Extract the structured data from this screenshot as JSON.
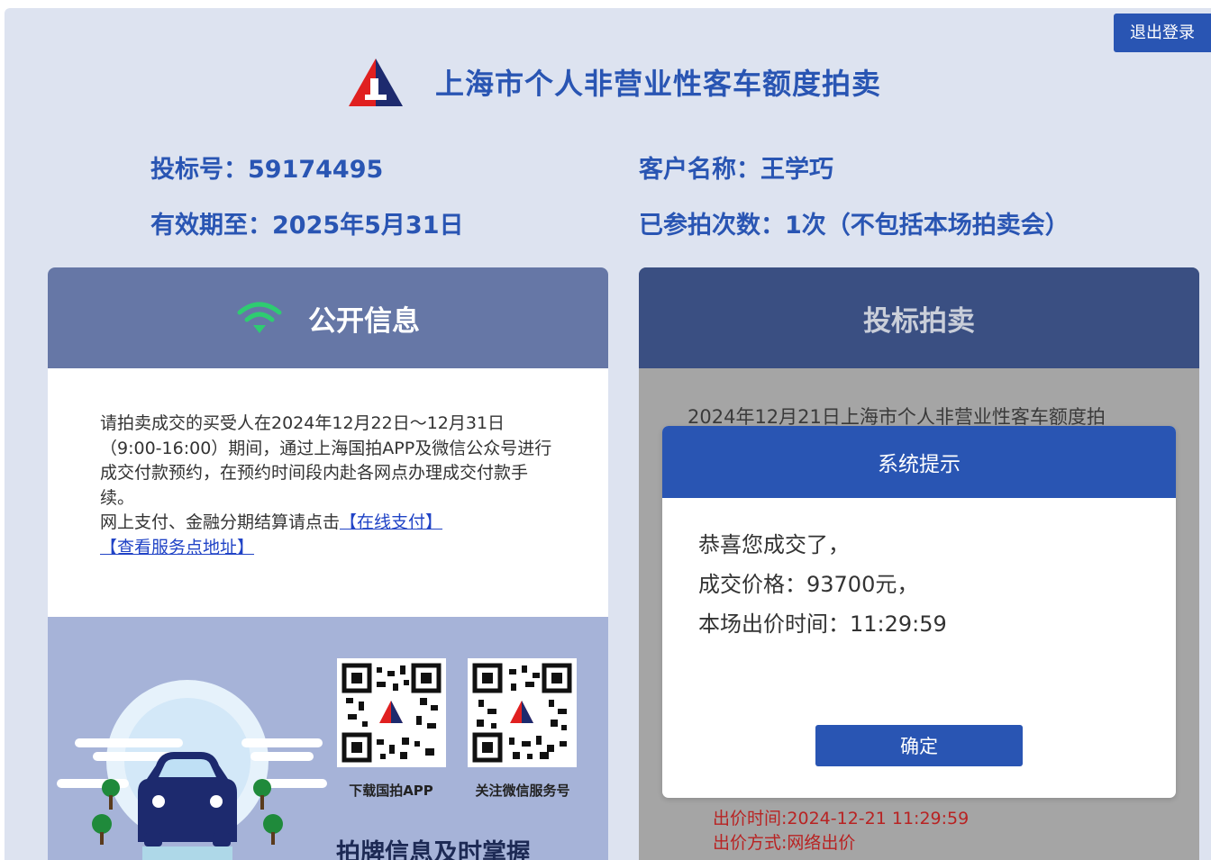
{
  "header": {
    "logout_label": "退出登录",
    "title": "上海市个人非营业性客车额度拍卖"
  },
  "account": {
    "bid_number_label": "投标号：",
    "bid_number": "59174495",
    "customer_label": "客户名称：",
    "customer_name": "王学巧",
    "valid_until_label": "有效期至：",
    "valid_until": "2025年5月31日",
    "participation_label": "已参拍次数：",
    "participation": "1次（不包括本场拍卖会）"
  },
  "public_info": {
    "title": "公开信息",
    "notice": "请拍卖成交的买受人在2024年12月22日～12月31日（9:00-16:00）期间，通过上海国拍APP及微信公众号进行成交付款预约，在预约时间段内赴各网点办理成交付款手续。",
    "pay_prefix": "网上支付、金融分期结算请点击",
    "pay_link": "【在线支付】",
    "service_link": "【查看服务点地址】",
    "qr_app_label": "下载国拍APP",
    "qr_wechat_label": "关注微信服务号",
    "slogan": "拍牌信息及时掌握"
  },
  "auction": {
    "title": "投标拍卖",
    "session_line": "2024年12月21日上海市个人非营业性客车额度拍",
    "bid_time": "出价时间:2024-12-21 11:29:59",
    "bid_method": "出价方式:网络出价"
  },
  "modal": {
    "title": "系统提示",
    "line1": "恭喜您成交了，",
    "line2": "成交价格：93700元，",
    "line3": "本场出价时间：11:29:59",
    "ok_label": "确定"
  },
  "colors": {
    "primary": "#2955b3",
    "page_bg": "#dde3f0",
    "panel_left_head": "#6677a6",
    "panel_right_head": "#3a4f82",
    "bid_text": "#b82323",
    "wifi_green": "#2ecc71"
  }
}
